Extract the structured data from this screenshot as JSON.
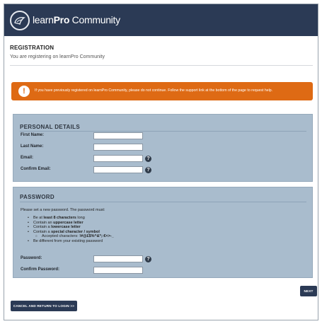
{
  "header": {
    "brand_light": "learn",
    "brand_bold": "Pro",
    "brand_suffix": " Community",
    "logo_icon": "learnpro-logo-icon",
    "background": "#2b3a55"
  },
  "page": {
    "title": "REGISTRATION",
    "subtitle": "You are registering on learnPro Community"
  },
  "alert": {
    "icon": "exclamation-icon",
    "text": "If you have previously registered on learnPro Community, please do not continue. Follow the support link at the bottom of the page to request help.",
    "color": "#de6a14"
  },
  "personal_details": {
    "title": "PERSONAL DETAILS",
    "fields": [
      {
        "label": "First Name:",
        "value": "",
        "help": false
      },
      {
        "label": "Last Name:",
        "value": "",
        "help": false
      },
      {
        "label": "Email:",
        "value": "",
        "help": true
      },
      {
        "label": "Confirm Email:",
        "value": "",
        "help": true
      }
    ]
  },
  "password": {
    "title": "PASSWORD",
    "intro": "Please set a new password. The password must:",
    "rules": [
      {
        "pre": "Be at ",
        "bold": "least 8 characters",
        "post": " long"
      },
      {
        "pre": "Contain an ",
        "bold": "uppercase letter",
        "post": ""
      },
      {
        "pre": "Contain a ",
        "bold": "lowercase letter",
        "post": ""
      },
      {
        "pre": "Contain a ",
        "bold": "special character / symbol",
        "post": ""
      }
    ],
    "accepted_label": "Accepted characters: ",
    "accepted_chars": "!#@£$%^&*;:€<>-_",
    "last_rule": "Be different from your existing password",
    "fields": [
      {
        "label": "Password:",
        "value": "",
        "help": true
      },
      {
        "label": "Confirm Password:",
        "value": "",
        "help": false
      }
    ]
  },
  "help_icon": "question-mark-icon",
  "buttons": {
    "next": "NEXT",
    "cancel": "CANCEL AND RETURN TO LOGIN >>"
  },
  "colors": {
    "panel": "#a9bccd",
    "accent_dark": "#2b3a55"
  }
}
